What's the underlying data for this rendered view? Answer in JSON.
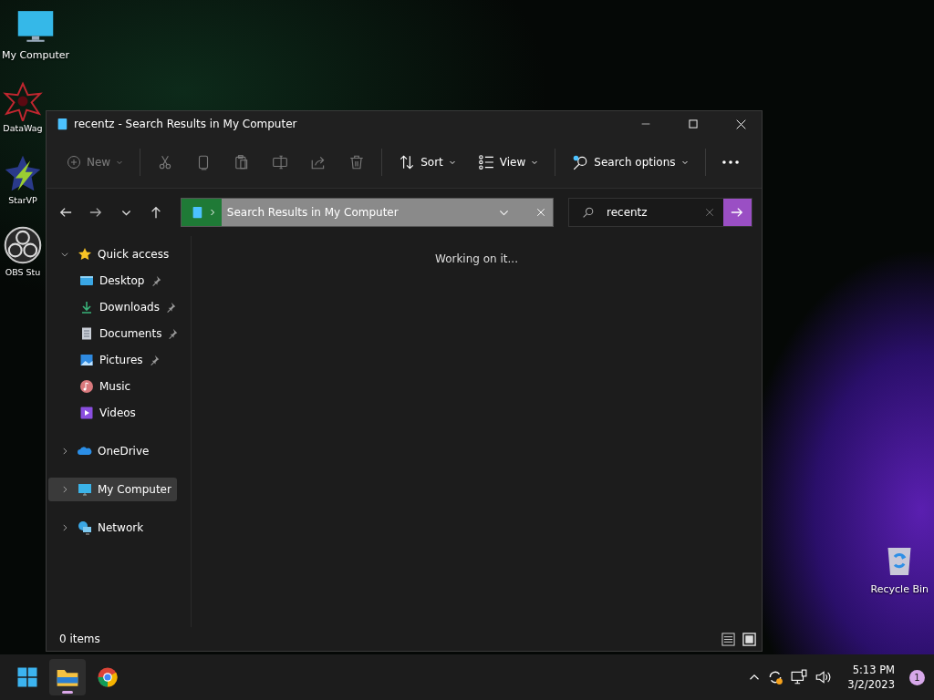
{
  "desktop_icons": [
    {
      "kind": "computer",
      "label": "My Computer"
    },
    {
      "kind": "app-star",
      "label": "DataWag"
    },
    {
      "kind": "app-bolt",
      "label": "StarVP"
    },
    {
      "kind": "app-obs",
      "label": "OBS Stu"
    }
  ],
  "recycle_bin": {
    "label": "Recycle Bin"
  },
  "window": {
    "title": "recentz - Search Results in My Computer",
    "toolbar": [
      {
        "kind": "new",
        "label": "New",
        "disabled": true
      },
      {
        "kind": "cut",
        "disabled": true
      },
      {
        "kind": "copy",
        "disabled": true
      },
      {
        "kind": "paste",
        "disabled": true
      },
      {
        "kind": "rename",
        "disabled": true
      },
      {
        "kind": "share",
        "disabled": true
      },
      {
        "kind": "delete",
        "disabled": true
      },
      {
        "kind": "sort",
        "label": "Sort",
        "disabled": false
      },
      {
        "kind": "view",
        "label": "View",
        "disabled": false
      },
      {
        "kind": "search-options",
        "label": "Search options",
        "disabled": false
      },
      {
        "kind": "more",
        "disabled": false
      }
    ],
    "address": {
      "breadcrumb": "Search Results in My Computer"
    },
    "search": {
      "value": "recentz"
    },
    "sidebar": [
      {
        "kind": "star",
        "label": "Quick access",
        "expanded": true,
        "selected": false,
        "children": [
          {
            "kind": "desktop",
            "label": "Desktop",
            "pinned": true,
            "selected": false
          },
          {
            "kind": "download",
            "label": "Downloads",
            "pinned": true,
            "selected": false
          },
          {
            "kind": "document",
            "label": "Documents",
            "pinned": true,
            "selected": false
          },
          {
            "kind": "picture",
            "label": "Pictures",
            "pinned": true,
            "selected": false
          },
          {
            "kind": "music",
            "label": "Music",
            "pinned": false,
            "selected": false
          },
          {
            "kind": "video",
            "label": "Videos",
            "pinned": false,
            "selected": false
          }
        ]
      },
      {
        "kind": "cloud",
        "label": "OneDrive",
        "expanded": false,
        "selected": false
      },
      {
        "kind": "computer",
        "label": "My Computer",
        "expanded": false,
        "selected": true
      },
      {
        "kind": "network",
        "label": "Network",
        "expanded": false,
        "selected": false
      }
    ],
    "content": {
      "message": "Working on it..."
    },
    "status_bar": {
      "item_count": "0 items"
    }
  },
  "taskbar": {
    "apps": [
      {
        "kind": "start",
        "active": false
      },
      {
        "kind": "explorer",
        "active": true
      },
      {
        "kind": "chrome",
        "active": false
      }
    ],
    "clock": {
      "time": "5:13 PM",
      "date": "3/2/2023"
    },
    "notification_count": "1"
  }
}
